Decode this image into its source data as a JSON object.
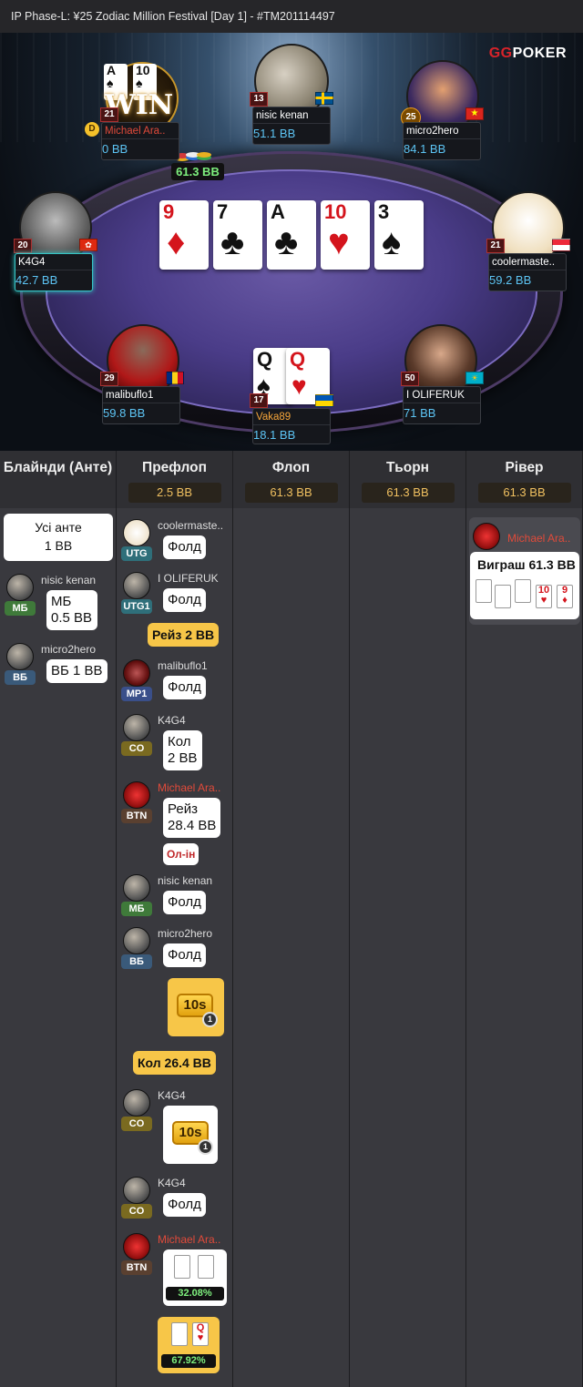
{
  "topbar": {
    "title": "IP  Phase-L: ¥25 Zodiac Million Festival [Day 1]   - #TM201114497"
  },
  "logo": {
    "gg": "GG",
    "poker": "POKER"
  },
  "pot": "61.3 BB",
  "board": [
    {
      "rank": "9",
      "suit": "♦",
      "color": "red"
    },
    {
      "rank": "7",
      "suit": "♣",
      "color": "blk"
    },
    {
      "rank": "A",
      "suit": "♣",
      "color": "blk"
    },
    {
      "rank": "10",
      "suit": "♥",
      "color": "red"
    },
    {
      "rank": "3",
      "suit": "♠",
      "color": "blk"
    }
  ],
  "seats": {
    "michael": {
      "name": "Michael Ara..",
      "stack": "0 BB",
      "level": "21",
      "win": "WIN",
      "cards": [
        "A",
        "10"
      ],
      "dealer": "D"
    },
    "nisic": {
      "name": "nisic kenan",
      "stack": "51.1 BB",
      "level": "13"
    },
    "micro2hero": {
      "name": "micro2hero",
      "stack": "84.1 BB",
      "level": "25"
    },
    "k4g4": {
      "name": "K4G4",
      "stack": "42.7 BB",
      "level": "20"
    },
    "cooler": {
      "name": "coolermaste..",
      "stack": "59.2 BB",
      "level": "21"
    },
    "malibuflo": {
      "name": "malibuflo1",
      "stack": "59.8 BB",
      "level": "29"
    },
    "vaka": {
      "name": "Vaka89",
      "stack": "18.1 BB",
      "level": "17",
      "cards": [
        "Q",
        "Q"
      ]
    },
    "oliferuk": {
      "name": "I OLIFERUK",
      "stack": "71 BB",
      "level": "50"
    }
  },
  "history": {
    "columns": [
      {
        "title": "Блайнди (Анте)",
        "value": ""
      },
      {
        "title": "Префлоп",
        "value": "2.5 BB"
      },
      {
        "title": "Флоп",
        "value": "61.3 BB"
      },
      {
        "title": "Тьорн",
        "value": "61.3 BB"
      },
      {
        "title": "Рівер",
        "value": "61.3 BB"
      }
    ],
    "blinds": {
      "ante_line1": "Усі анте",
      "ante_line2": "1 BB",
      "sb_name": "nisic kenan",
      "sb_pos": "МБ",
      "sb_line1": "МБ",
      "sb_line2": "0.5 BB",
      "bb_name": "micro2hero",
      "bb_pos": "ВБ",
      "bb_text": "ВБ 1 BB"
    },
    "preflop": {
      "a1_name": "coolermaste..",
      "a1_pos": "UTG",
      "a1_act": "Фолд",
      "a2_name": "I OLIFERUK",
      "a2_pos": "UTG1",
      "a2_act": "Фолд",
      "a3_act": "Рейз 2 BB",
      "a4_name": "malibuflo1",
      "a4_pos": "MP1",
      "a4_act": "Фолд",
      "a5_name": "K4G4",
      "a5_pos": "CO",
      "a5_act1": "Кол",
      "a5_act2": "2 BB",
      "a6_name": "Michael Ara..",
      "a6_pos": "BTN",
      "a6_act1": "Рейз",
      "a6_act2": "28.4 BB",
      "a6_allin": "Ол-ін",
      "a7_name": "nisic kenan",
      "a7_pos": "МБ",
      "a7_act": "Фолд",
      "a8_name": "micro2hero",
      "a8_pos": "ВБ",
      "a8_act": "Фолд",
      "timer1": "10s",
      "timer1_count": "1",
      "a9_act": "Кол 26.4 BB",
      "a10_name": "K4G4",
      "a10_pos": "CO",
      "timer2": "10s",
      "timer2_count": "1",
      "a11_name": "K4G4",
      "a11_pos": "CO",
      "a11_act": "Фолд",
      "a12_name": "Michael Ara..",
      "a12_pos": "BTN",
      "a12_cards": [
        "A",
        "10"
      ],
      "a12_equity": "32.08%",
      "a13_cards": [
        "Q",
        "Q"
      ],
      "a13_equity": "67.92%"
    },
    "river": {
      "name": "Michael Ara..",
      "win": "Виграш 61.3 BB",
      "cards": [
        "A",
        "A",
        "10",
        "10",
        "9"
      ]
    }
  },
  "colors": {
    "accent": "#f7c648",
    "stack": "#5dc5f5",
    "winner": "#e04a3a",
    "equity": "#7ef07e"
  }
}
